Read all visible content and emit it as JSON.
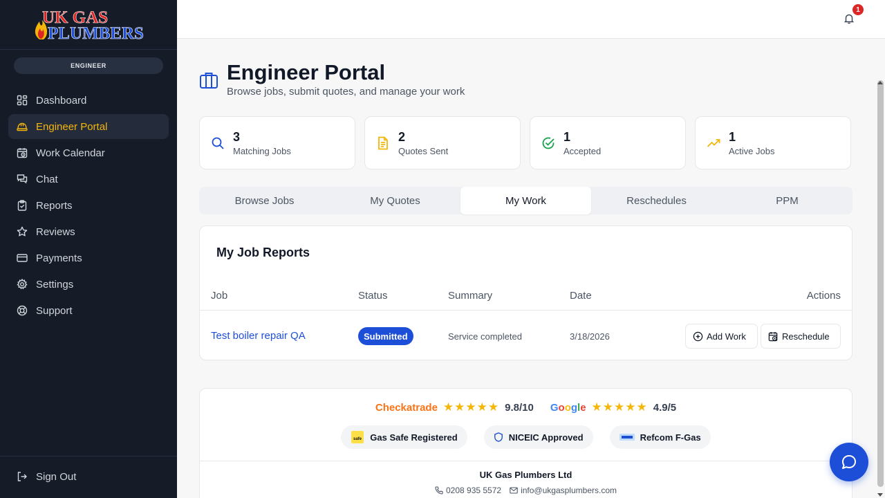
{
  "brand": {
    "line1": "UK GAS",
    "line2": "PLUMBERS"
  },
  "role": "ENGINEER",
  "sidebar": {
    "items": [
      {
        "label": "Dashboard",
        "icon": "dashboard-icon"
      },
      {
        "label": "Engineer Portal",
        "icon": "hard-hat-icon",
        "active": true
      },
      {
        "label": "Work Calendar",
        "icon": "calendar-clock-icon"
      },
      {
        "label": "Chat",
        "icon": "chat-icon"
      },
      {
        "label": "Reports",
        "icon": "clipboard-icon"
      },
      {
        "label": "Reviews",
        "icon": "star-icon"
      },
      {
        "label": "Payments",
        "icon": "credit-card-icon"
      },
      {
        "label": "Settings",
        "icon": "gear-icon"
      },
      {
        "label": "Support",
        "icon": "lifebuoy-icon"
      }
    ],
    "sign_out": "Sign Out"
  },
  "topbar": {
    "notification_count": "1"
  },
  "page": {
    "title": "Engineer Portal",
    "subtitle": "Browse jobs, submit quotes, and manage your work"
  },
  "stats": [
    {
      "value": "3",
      "label": "Matching Jobs",
      "icon": "search-icon",
      "color": "#1d4ed8"
    },
    {
      "value": "2",
      "label": "Quotes Sent",
      "icon": "document-icon",
      "color": "#f5b60a"
    },
    {
      "value": "1",
      "label": "Accepted",
      "icon": "check-circle-icon",
      "color": "#16a34a"
    },
    {
      "value": "1",
      "label": "Active Jobs",
      "icon": "trending-up-icon",
      "color": "#f5b60a"
    }
  ],
  "tabs": [
    {
      "label": "Browse Jobs"
    },
    {
      "label": "My Quotes"
    },
    {
      "label": "My Work",
      "active": true
    },
    {
      "label": "Reschedules"
    },
    {
      "label": "PPM"
    }
  ],
  "reports": {
    "title": "My Job Reports",
    "columns": {
      "job": "Job",
      "status": "Status",
      "summary": "Summary",
      "date": "Date",
      "actions": "Actions"
    },
    "rows": [
      {
        "job": "Test boiler repair QA",
        "status": "Submitted",
        "summary": "Service completed",
        "date": "3/18/2026"
      }
    ],
    "add_work_label": "Add Work",
    "reschedule_label": "Reschedule"
  },
  "footer": {
    "checkatrade": {
      "name": "Checkatrade",
      "stars": "★★★★★",
      "score": "9.8/10"
    },
    "google": {
      "stars": "★★★★★",
      "score": "4.9/5"
    },
    "badges": {
      "gas_safe": "Gas Safe Registered",
      "niceic": "NICEIC Approved",
      "refcom": "Refcom F-Gas"
    },
    "company": "UK Gas Plumbers Ltd",
    "phone": "0208 935 5572",
    "email": "info@ukgasplumbers.com"
  },
  "colors": {
    "accent": "#f5b60a",
    "primary": "#1d4ed8",
    "sidebar": "#151b27"
  }
}
